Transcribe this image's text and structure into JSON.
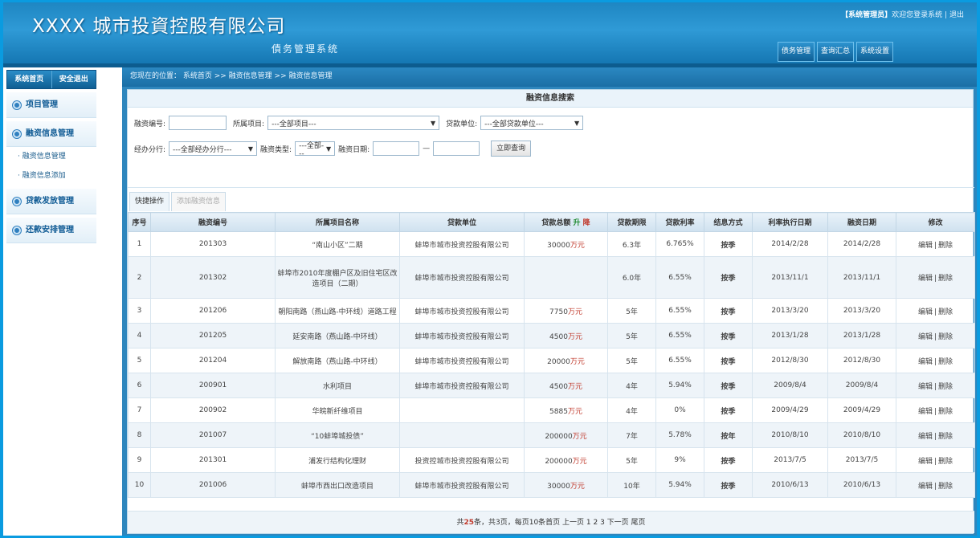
{
  "header": {
    "logo": "XXXX 城市投資控股有限公司",
    "subtitle": "債务管理系统",
    "user_role": "【系统管理员】",
    "welcome": "欢迎您登录系统",
    "separator": "|",
    "logout": "退出",
    "nav": [
      "债务管理",
      "查询汇总",
      "系统设置"
    ]
  },
  "sidebar": {
    "top_buttons": [
      "系统首页",
      "安全退出"
    ],
    "menu": [
      {
        "label": "项目管理"
      },
      {
        "label": "融资信息管理",
        "children": [
          "融资信息管理",
          "融资信息添加"
        ]
      },
      {
        "label": "贷款发放管理"
      },
      {
        "label": "还款安排管理"
      }
    ]
  },
  "breadcrumb": "您现在的位置： 系统首页 >> 融资信息管理 >> 融资信息管理",
  "search": {
    "title": "融资信息搜索",
    "code_label": "融资编号:",
    "project_label": "所属项目:",
    "project_value": "---全部项目---",
    "lender_label": "贷款单位:",
    "lender_value": "---全部贷款单位---",
    "branch_label": "经办分行:",
    "branch_value": "---全部经办分行---",
    "type_label": "融资类型:",
    "type_value": "---全部---",
    "date_label": "融资日期:",
    "date_sep": "—",
    "query_button": "立即查询"
  },
  "tabs": [
    "快捷操作",
    "添加融资信息"
  ],
  "table": {
    "headers": [
      "序号",
      "融资编号",
      "所属项目名称",
      "贷款单位",
      "贷款总额",
      "升",
      "降",
      "贷款期限",
      "贷款利率",
      "结息方式",
      "利率执行日期",
      "融资日期",
      "修改"
    ],
    "rows": [
      {
        "no": "1",
        "code": "201303",
        "project": "“南山小区”二期",
        "lender": "蚌埠市城市投资控股有限公司",
        "amount": "30000",
        "unit": "万元",
        "term": "6.3年",
        "rate": "6.765%",
        "method": "按季",
        "rate_date": "2014/2/28",
        "date": "2014/2/28"
      },
      {
        "no": "2",
        "code": "201302",
        "project": "蚌埠市2010年度棚户区及旧住宅区改造项目（二期）",
        "lender": "蚌埠市城市投资控股有限公司",
        "amount": "",
        "unit": "",
        "term": "6.0年",
        "rate": "6.55%",
        "method": "按季",
        "rate_date": "2013/11/1",
        "date": "2013/11/1"
      },
      {
        "no": "3",
        "code": "201206",
        "project": "朝阳南路（燕山路-中环线）道路工程",
        "lender": "蚌埠市城市投资控股有限公司",
        "amount": "7750",
        "unit": "万元",
        "term": "5年",
        "rate": "6.55%",
        "method": "按季",
        "rate_date": "2013/3/20",
        "date": "2013/3/20"
      },
      {
        "no": "4",
        "code": "201205",
        "project": "延安南路（燕山路-中环线）",
        "lender": "蚌埠市城市投资控股有限公司",
        "amount": "4500",
        "unit": "万元",
        "term": "5年",
        "rate": "6.55%",
        "method": "按季",
        "rate_date": "2013/1/28",
        "date": "2013/1/28"
      },
      {
        "no": "5",
        "code": "201204",
        "project": "解放南路（燕山路-中环线）",
        "lender": "蚌埠市城市投资控股有限公司",
        "amount": "20000",
        "unit": "万元",
        "term": "5年",
        "rate": "6.55%",
        "method": "按季",
        "rate_date": "2012/8/30",
        "date": "2012/8/30"
      },
      {
        "no": "6",
        "code": "200901",
        "project": "水利项目",
        "lender": "蚌埠市城市投资控股有限公司",
        "amount": "4500",
        "unit": "万元",
        "term": "4年",
        "rate": "5.94%",
        "method": "按季",
        "rate_date": "2009/8/4",
        "date": "2009/8/4"
      },
      {
        "no": "7",
        "code": "200902",
        "project": "华皖新纤维项目",
        "lender": "",
        "amount": "5885",
        "unit": "万元",
        "term": "4年",
        "rate": "0%",
        "method": "按季",
        "rate_date": "2009/4/29",
        "date": "2009/4/29"
      },
      {
        "no": "8",
        "code": "201007",
        "project": "“10蚌埠城投债”",
        "lender": "",
        "amount": "200000",
        "unit": "万元",
        "term": "7年",
        "rate": "5.78%",
        "method": "按年",
        "rate_date": "2010/8/10",
        "date": "2010/8/10"
      },
      {
        "no": "9",
        "code": "201301",
        "project": "浦发行结构化理财",
        "lender": "投资控城市投资控股有限公司",
        "amount": "200000",
        "unit": "万元",
        "term": "5年",
        "rate": "9%",
        "method": "按季",
        "rate_date": "2013/7/5",
        "date": "2013/7/5"
      },
      {
        "no": "10",
        "code": "201006",
        "project": "蚌埠市西出口改造项目",
        "lender": "蚌埠市城市投资控股有限公司",
        "amount": "30000",
        "unit": "万元",
        "term": "10年",
        "rate": "5.94%",
        "method": "按季",
        "rate_date": "2010/6/13",
        "date": "2010/6/13"
      }
    ],
    "edit": "编辑",
    "delete": "删除"
  },
  "pager": {
    "prefix": "共",
    "total": "25",
    "suffix": "条，共3页，每页10条首页 上一页 1 2 3 下一页 尾页"
  }
}
